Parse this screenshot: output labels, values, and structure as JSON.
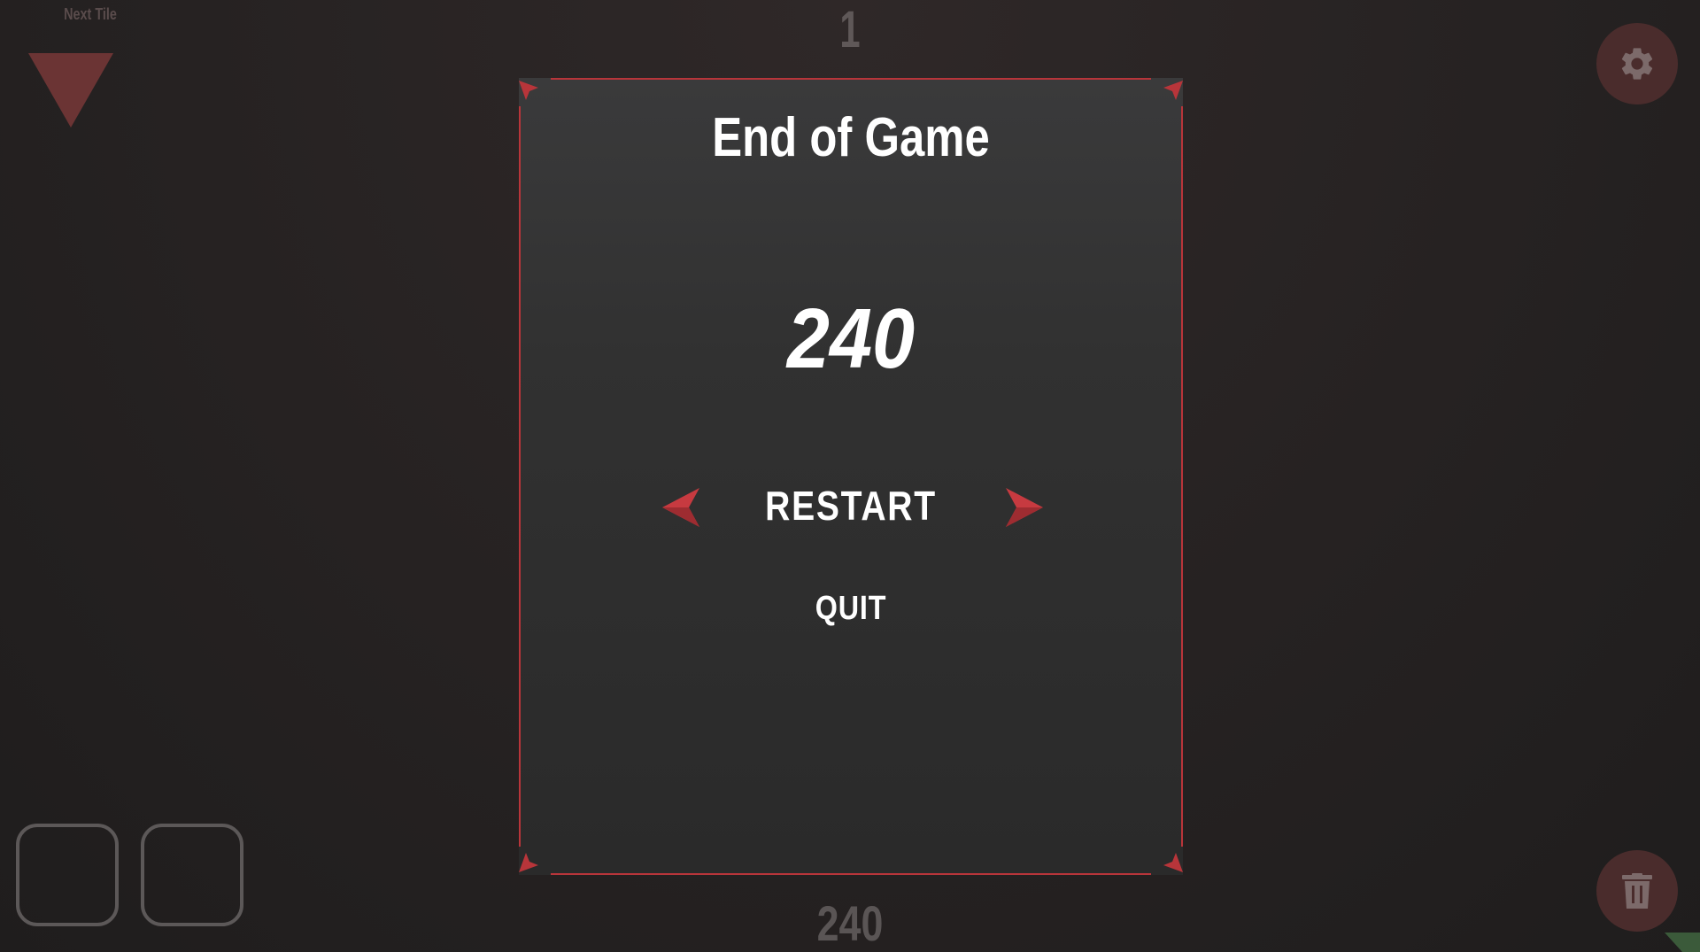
{
  "hud": {
    "next_tile_label": "Next Tile",
    "level": "1",
    "score": "240"
  },
  "dialog": {
    "title": "End of Game",
    "final_score": "240",
    "restart_label": "RESTART",
    "quit_label": "QUIT"
  },
  "icons": {
    "settings": "gear-icon",
    "trash": "trash-icon",
    "next_tile": "triangle-down-icon"
  },
  "colors": {
    "accent_red": "#b8353a",
    "button_bg": "#4a2c2c"
  }
}
